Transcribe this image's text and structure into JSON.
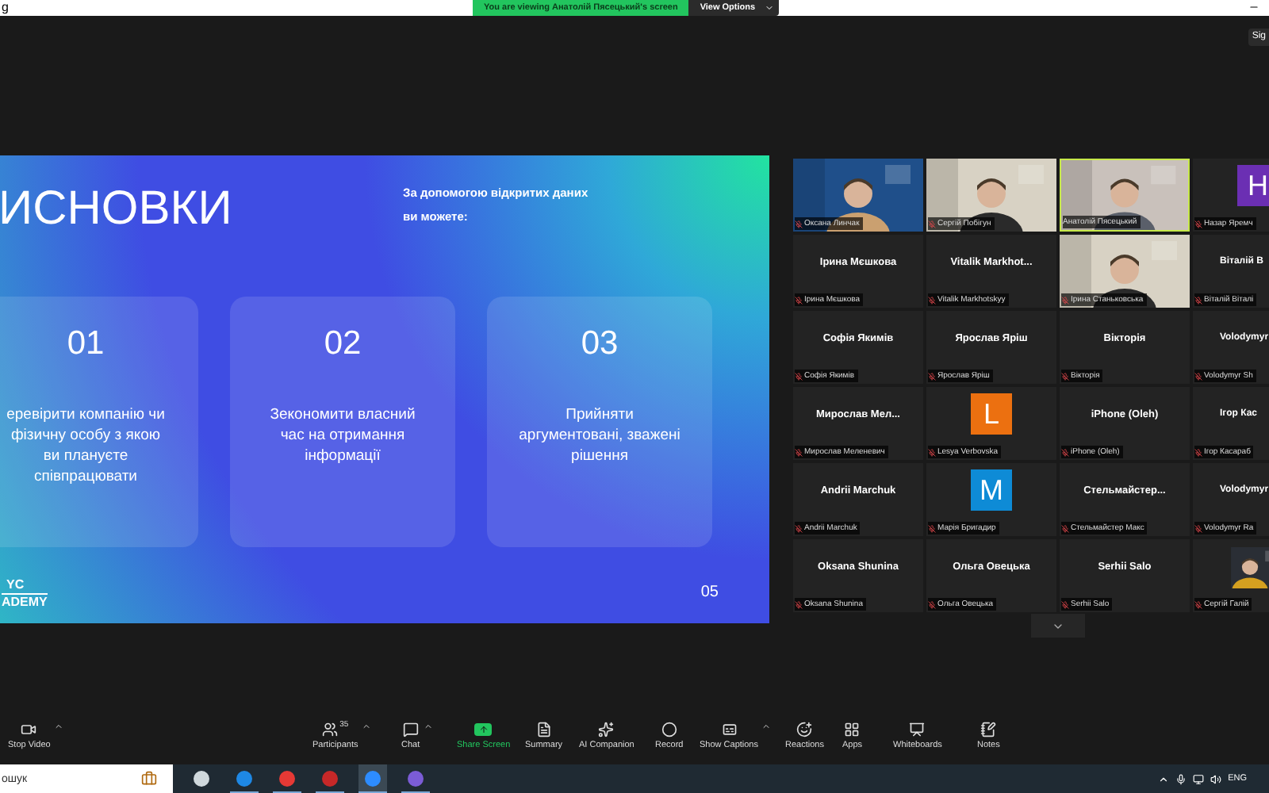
{
  "window": {
    "title": "g"
  },
  "share_banner": {
    "text": "You are viewing Анатолій Пясецький's screen",
    "button": "View Options"
  },
  "corner_label": "Sig",
  "slide": {
    "title": "ИСНОВКИ",
    "subtitle": "За допомогою відкритих даних ви можете:",
    "cards": [
      {
        "number": "01",
        "text": "еревірити компанію чи фізичну особу з якою ви плануєте співпрацювати"
      },
      {
        "number": "02",
        "text": "Зекономити власний час на отримання інформації"
      },
      {
        "number": "03",
        "text": "Прийняти аргументовані, зважені рішення"
      }
    ],
    "logo_top": "YC",
    "logo_bottom": "ADEMY",
    "page": "05"
  },
  "tiles": [
    {
      "kind": "video",
      "label": "Оксана Линчак",
      "muted": true,
      "speaking": false
    },
    {
      "kind": "video",
      "label": "Сергій Побігун",
      "muted": true,
      "speaking": false
    },
    {
      "kind": "video",
      "label": "Анатолій Пясецький",
      "muted": false,
      "speaking": true
    },
    {
      "kind": "avatar",
      "letter": "Н",
      "color": "#6b2fb3",
      "label": "Назар Яремч",
      "muted": true,
      "speaking": false
    },
    {
      "kind": "name",
      "display": "Ірина Мєшкова",
      "label": "Ірина Мєшкова",
      "muted": true,
      "speaking": false
    },
    {
      "kind": "name",
      "display": "Vitalik  Markhot...",
      "label": "Vitalik Markhotskyy",
      "muted": true,
      "speaking": false
    },
    {
      "kind": "video",
      "label": "Ірина Станьковська",
      "muted": true,
      "speaking": false
    },
    {
      "kind": "name",
      "display": "Віталій В",
      "label": "Віталій Віталі",
      "muted": true,
      "speaking": false
    },
    {
      "kind": "name",
      "display": "Софія Якимів",
      "label": "Софія Якимів",
      "muted": true,
      "speaking": false
    },
    {
      "kind": "name",
      "display": "Ярослав Яріш",
      "label": "Ярослав Яріш",
      "muted": true,
      "speaking": false
    },
    {
      "kind": "name",
      "display": "Вікторія",
      "label": "Вікторія",
      "muted": true,
      "speaking": false
    },
    {
      "kind": "name",
      "display": "Volodymyr",
      "label": "Volodymyr Sh",
      "muted": true,
      "speaking": false
    },
    {
      "kind": "name",
      "display": "Мирослав  Мел...",
      "label": "Мирослав Меленевич",
      "muted": true,
      "speaking": false
    },
    {
      "kind": "avatar",
      "letter": "L",
      "color": "#ec7010",
      "label": "Lesya Verbovska",
      "muted": true,
      "speaking": false
    },
    {
      "kind": "name",
      "display": "iPhone (Oleh)",
      "label": "iPhone (Oleh)",
      "muted": true,
      "speaking": false
    },
    {
      "kind": "name",
      "display": "Ігор Кас",
      "label": "Ігор Касараб",
      "muted": true,
      "speaking": false
    },
    {
      "kind": "name",
      "display": "Andrii Marchuk",
      "label": "Andrii Marchuk",
      "muted": true,
      "speaking": false
    },
    {
      "kind": "avatar",
      "letter": "M",
      "color": "#0e8bd6",
      "label": "Марія Бригадир",
      "muted": true,
      "speaking": false
    },
    {
      "kind": "name",
      "display": "Стельмайстер...",
      "label": "Стельмайстер Макс",
      "muted": true,
      "speaking": false
    },
    {
      "kind": "name",
      "display": "Volodymyr",
      "label": "Volodymyr Ra",
      "muted": true,
      "speaking": false
    },
    {
      "kind": "name",
      "display": "Oksana Shunina",
      "label": "Oksana Shunina",
      "muted": true,
      "speaking": false
    },
    {
      "kind": "name",
      "display": "Ольга Овецька",
      "label": "Ольга Овецька",
      "muted": true,
      "speaking": false
    },
    {
      "kind": "name",
      "display": "Serhii Salo",
      "label": "Serhii Salo",
      "muted": true,
      "speaking": false
    },
    {
      "kind": "thumb",
      "label": "Сергій Галій",
      "muted": true,
      "speaking": false
    }
  ],
  "toolbar": [
    {
      "label": "Stop Video",
      "caret": true,
      "highlighted": false
    },
    {
      "label": "Participants",
      "count": "35",
      "caret": true,
      "highlighted": false
    },
    {
      "label": "Chat",
      "caret": true,
      "highlighted": false
    },
    {
      "label": "Share Screen",
      "caret": false,
      "highlighted": true
    },
    {
      "label": "Summary",
      "caret": false,
      "highlighted": false
    },
    {
      "label": "AI Companion",
      "caret": false,
      "highlighted": false
    },
    {
      "label": "Record",
      "caret": false,
      "highlighted": false
    },
    {
      "label": "Show Captions",
      "caret": true,
      "highlighted": false
    },
    {
      "label": "Reactions",
      "caret": false,
      "highlighted": false
    },
    {
      "label": "Apps",
      "caret": false,
      "highlighted": false
    },
    {
      "label": "Whiteboards",
      "caret": false,
      "highlighted": false
    },
    {
      "label": "Notes",
      "caret": false,
      "highlighted": false
    }
  ],
  "taskbar": {
    "search": {
      "placeholder": "ошук"
    },
    "apps": [
      {
        "selected": false
      },
      {
        "selected": false
      },
      {
        "selected": false
      },
      {
        "selected": false
      },
      {
        "selected": true
      },
      {
        "selected": false
      }
    ],
    "language": "ENG"
  }
}
